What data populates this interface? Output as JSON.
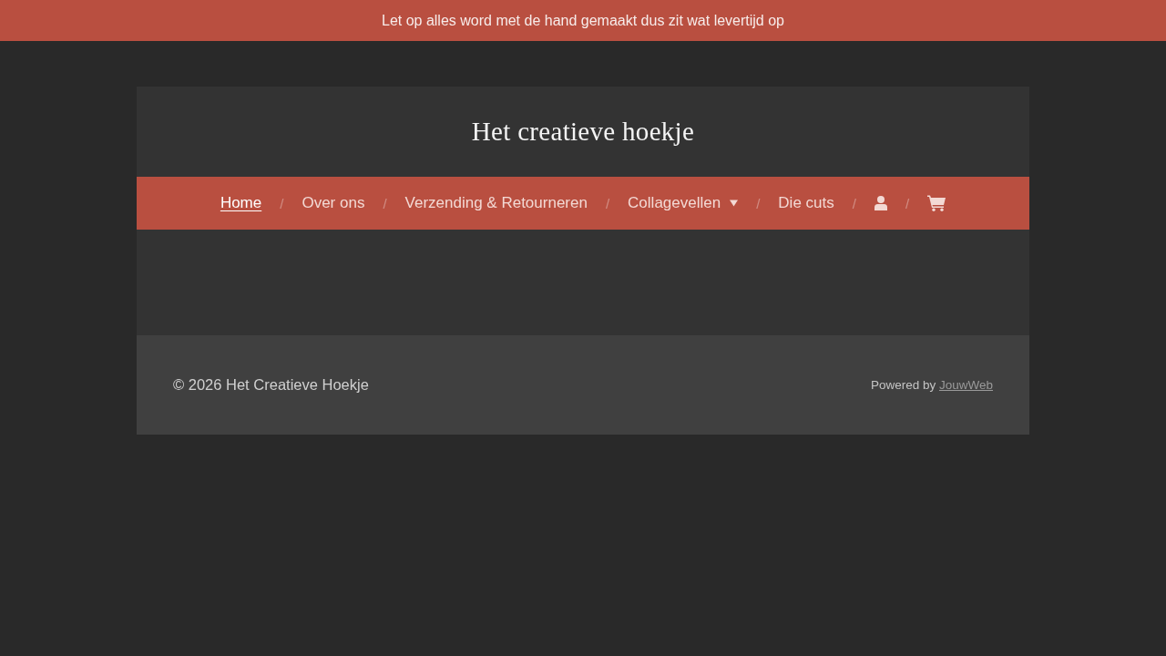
{
  "announcement_bar": {
    "text": "Let op alles word met de hand gemaakt dus zit wat levertijd op"
  },
  "header": {
    "site_title": "Het creatieve hoekje"
  },
  "nav": {
    "separator": "/",
    "items": [
      {
        "kind": "link",
        "label": "Home",
        "selected": true
      },
      {
        "kind": "link",
        "label": "Over ons",
        "selected": false
      },
      {
        "kind": "link",
        "label": "Verzending & Retourneren",
        "selected": false
      },
      {
        "kind": "dropdown",
        "label": "Collagevellen",
        "selected": false
      },
      {
        "kind": "link",
        "label": "Die cuts",
        "selected": false
      },
      {
        "kind": "account",
        "selected": false
      },
      {
        "kind": "cart",
        "selected": false
      }
    ]
  },
  "footer": {
    "copyright": "© 2026 Het Creatieve Hoekje",
    "powered_by": {
      "text": "Powered by",
      "link": "JouwWeb"
    }
  }
}
